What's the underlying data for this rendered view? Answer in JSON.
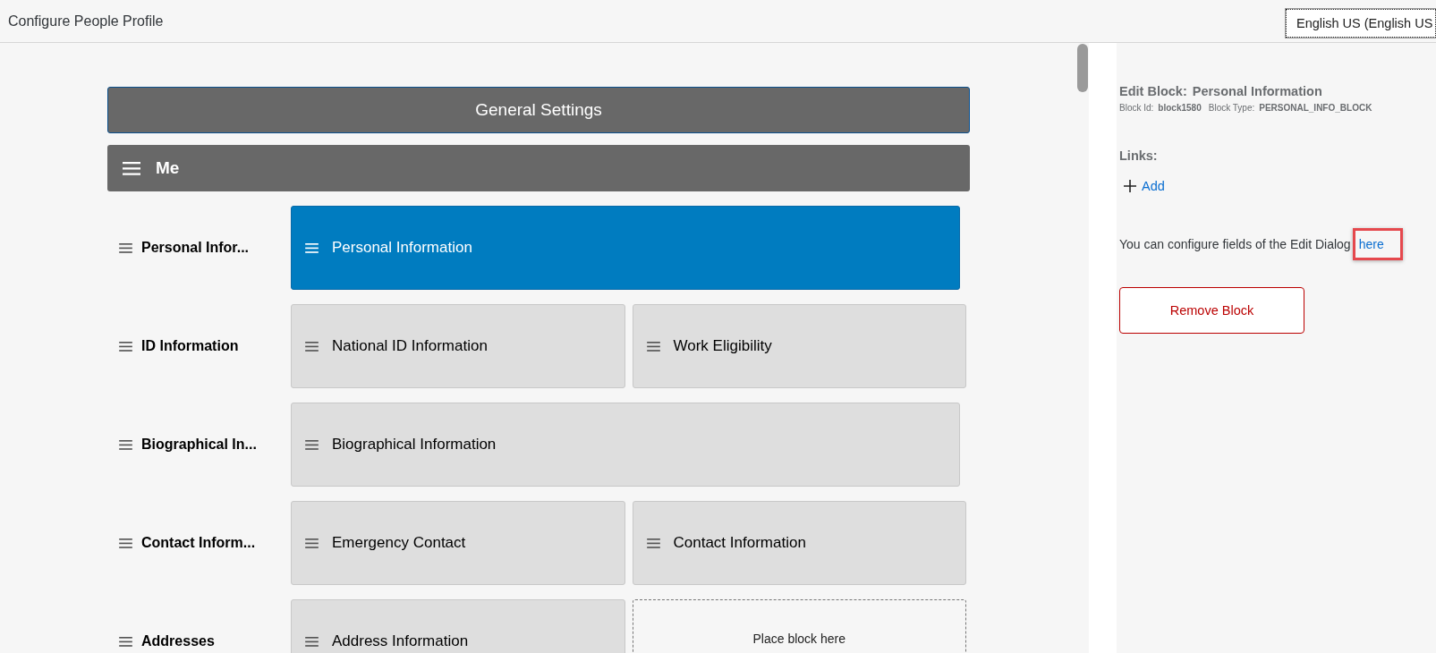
{
  "header": {
    "title": "Configure People Profile",
    "language": "English US (English US"
  },
  "general_settings": "General Settings",
  "section": {
    "title": "Me"
  },
  "rows": [
    {
      "label": "Personal Infor...",
      "blocks": [
        {
          "kind": "block",
          "text": "Personal Information",
          "selected": true
        }
      ]
    },
    {
      "label": "ID Information",
      "blocks": [
        {
          "kind": "block",
          "text": "National ID Information",
          "selected": false
        },
        {
          "kind": "block",
          "text": "Work Eligibility",
          "selected": false
        }
      ]
    },
    {
      "label": "Biographical In...",
      "blocks": [
        {
          "kind": "block",
          "text": "Biographical Information",
          "selected": false
        }
      ]
    },
    {
      "label": "Contact Inform...",
      "blocks": [
        {
          "kind": "block",
          "text": "Emergency Contact",
          "selected": false
        },
        {
          "kind": "block",
          "text": "Contact Information",
          "selected": false
        }
      ]
    },
    {
      "label": "Addresses",
      "blocks": [
        {
          "kind": "block",
          "text": "Address Information",
          "selected": false
        },
        {
          "kind": "placeholder",
          "text": "Place block here"
        }
      ]
    }
  ],
  "panel": {
    "title_label": "Edit Block:",
    "title_value": "Personal Information",
    "id_label": "Block Id:",
    "id_value": "block1580",
    "type_label": "Block Type:",
    "type_value": "PERSONAL_INFO_BLOCK",
    "links_label": "Links:",
    "add_link": "Add",
    "note": "You can configure fields of the Edit Dialog",
    "note_link": {
      "text": "here",
      "highlighted": true
    },
    "remove_button": "Remove Block"
  }
}
